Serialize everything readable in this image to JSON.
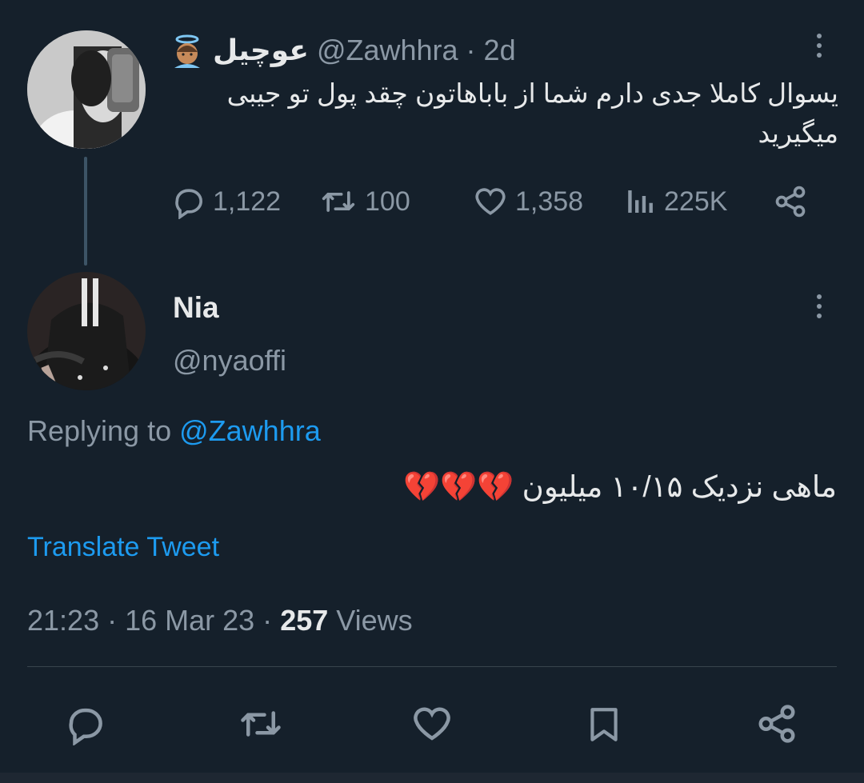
{
  "parent_tweet": {
    "display_name": "عوچیل",
    "handle": "@Zawhhra",
    "separator": "·",
    "time_ago": "2d",
    "text_line1": "یسوال کاملا جدی دارم شما از باباهاتون چقد پول تو جیبی",
    "text_line2": "میگیرید",
    "stats": {
      "replies": "1,122",
      "retweets": "100",
      "likes": "1,358",
      "views": "225K"
    }
  },
  "reply_tweet": {
    "display_name": "Nia",
    "handle": "@nyaoffi",
    "replying_prefix": "Replying to",
    "replying_to": "@Zawhhra",
    "text": "ماهی نزدیک ۱۰/۱۵ میلیون 💔💔💔",
    "translate_label": "Translate Tweet",
    "timestamp": "21:23 · 16 Mar 23 ·",
    "views_count": "257",
    "views_label": "Views"
  },
  "colors": {
    "background": "#15202b",
    "text": "#e7e9ea",
    "muted": "#8b98a5",
    "accent": "#1d9bf0"
  },
  "icons": [
    "more-icon",
    "reply-icon",
    "retweet-icon",
    "like-icon",
    "views-icon",
    "share-icon",
    "bookmark-icon",
    "angel-emoji",
    "broken-heart-emoji"
  ]
}
